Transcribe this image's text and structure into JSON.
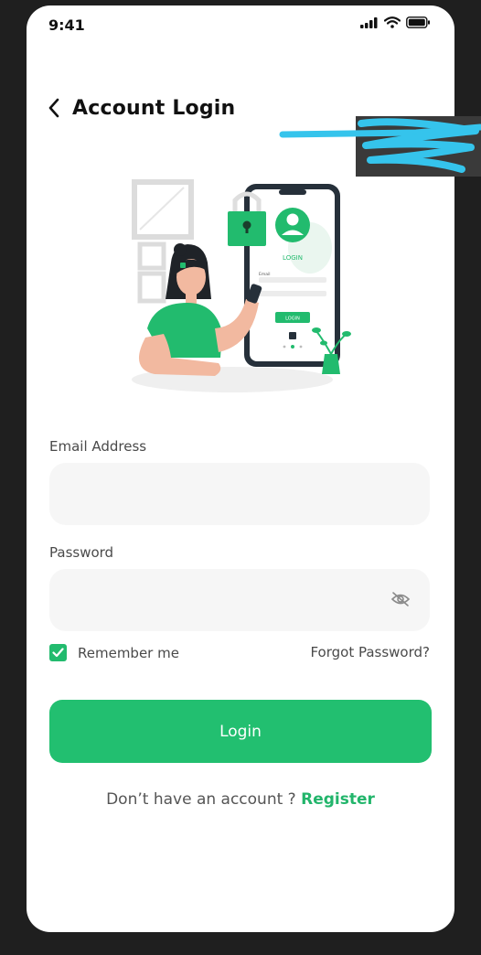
{
  "status_bar": {
    "time": "9:41",
    "icons": [
      "signal-icon",
      "wifi-icon",
      "battery-icon"
    ]
  },
  "header": {
    "back_icon": "chevron-left-icon",
    "title": "Account Login"
  },
  "illustration": {
    "label": "LOGIN",
    "email_label": "Email",
    "button_label": "LOGIN"
  },
  "form": {
    "email_label": "Email Address",
    "email_value": "",
    "password_label": "Password",
    "password_value": "",
    "password_toggle_icon": "eye-off-icon",
    "remember_label": "Remember me",
    "remember_checked": true,
    "forgot_label": "Forgot Password?",
    "login_label": "Login"
  },
  "footer": {
    "prompt": "Don’t have an account ?",
    "register_label": "Register"
  },
  "colors": {
    "accent": "#22bf70",
    "field_bg": "#f6f6f6",
    "background": "#1f1f1f"
  }
}
